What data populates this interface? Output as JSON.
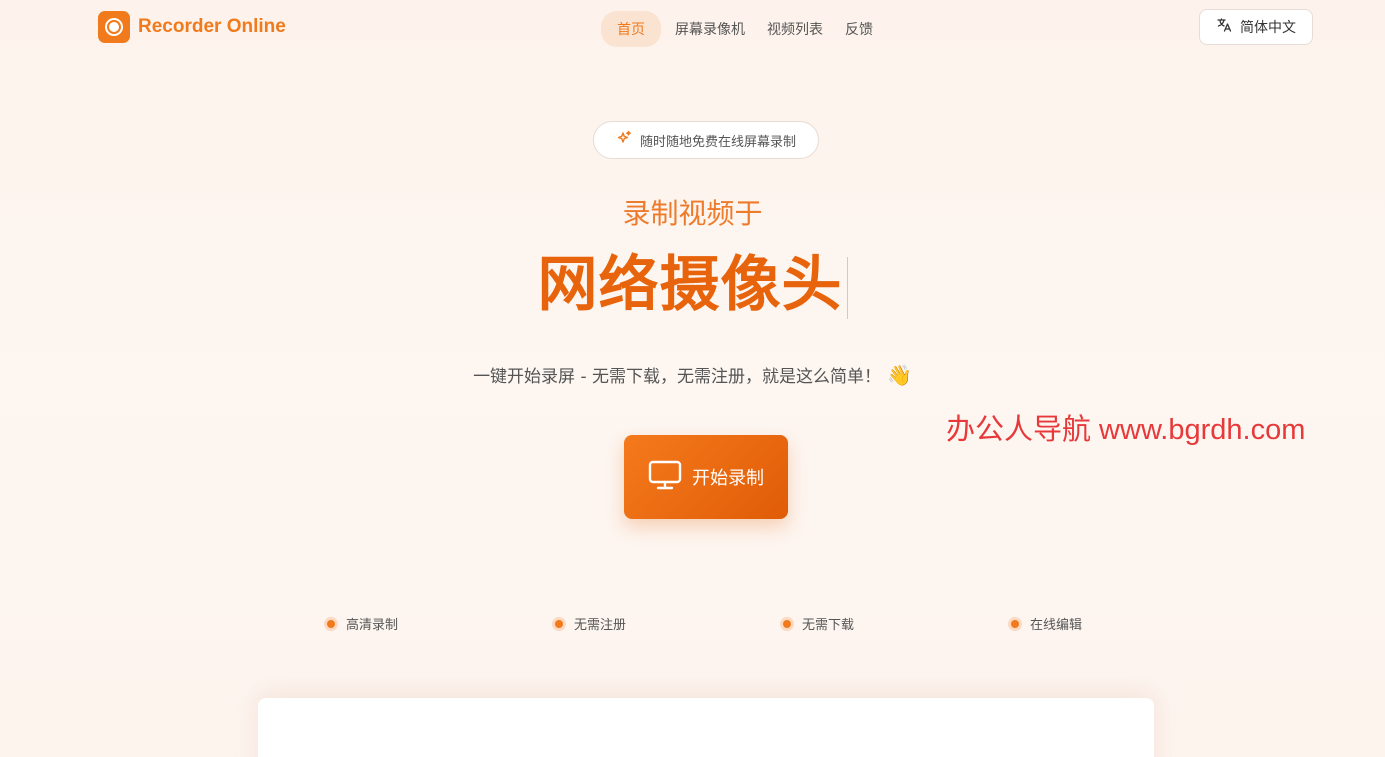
{
  "app": {
    "name": "Recorder Online",
    "brand_color": "#f07a1c"
  },
  "nav": {
    "items": [
      {
        "label": "首页",
        "active": true
      },
      {
        "label": "屏幕录像机",
        "active": false
      },
      {
        "label": "视频列表",
        "active": false
      },
      {
        "label": "反馈",
        "active": false
      }
    ]
  },
  "language": {
    "label": "简体中文",
    "icon": "translate-icon"
  },
  "hero": {
    "badge": "随时随地免费在线屏幕录制",
    "badge_icon": "sparkle-icon",
    "subtitle": "录制视频于",
    "title": "网络摄像头",
    "tagline": "一键开始录屏 - 无需下载，无需注册，就是这么简单！",
    "tagline_emoji": "👋",
    "start_button": "开始录制",
    "start_icon": "monitor-icon"
  },
  "watermark": "办公人导航 www.bgrdh.com",
  "features": [
    "高清录制",
    "无需注册",
    "无需下载",
    "在线编辑"
  ]
}
